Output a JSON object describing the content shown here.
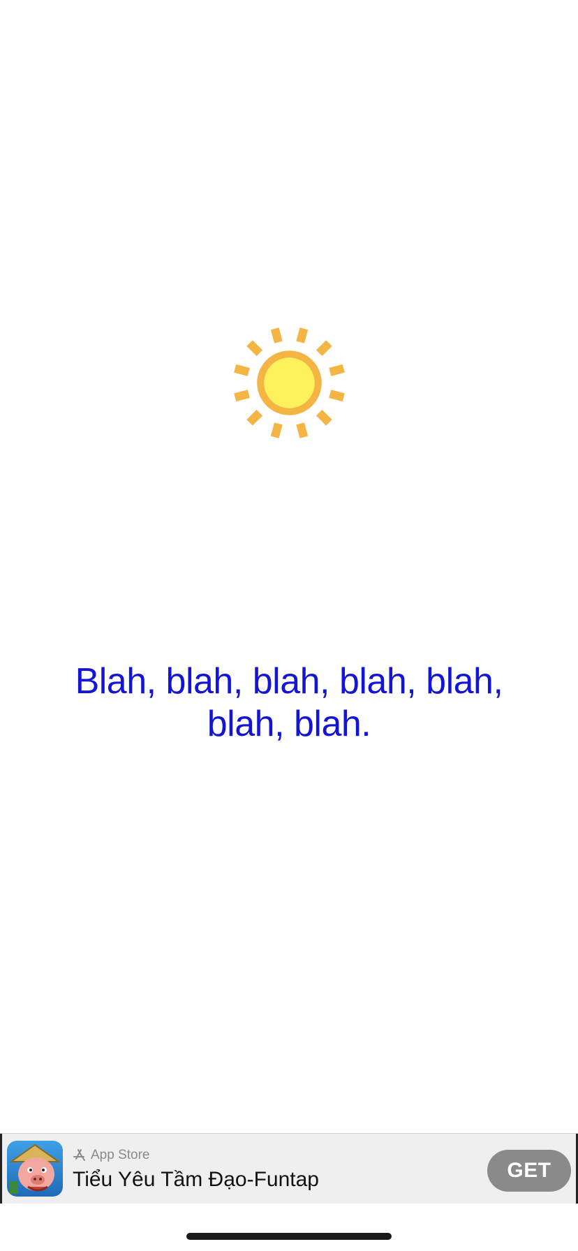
{
  "message": {
    "text": "Blah, blah, blah, blah, blah, blah, blah."
  },
  "sun": {
    "icon": "sun-icon",
    "ray_color": "#f5b544",
    "ring_color": "#f5b544",
    "core_color": "#fdf25b"
  },
  "ad": {
    "store_icon": "app-store-icon",
    "store_label": "App Store",
    "app_name": "Tiểu Yêu Tầm Đạo-Funtap",
    "get_label": "GET",
    "app_icon": "game-character-icon"
  },
  "colors": {
    "message_text": "#1414d4",
    "ad_background": "#efefef",
    "get_button": "#8a8a8a"
  }
}
